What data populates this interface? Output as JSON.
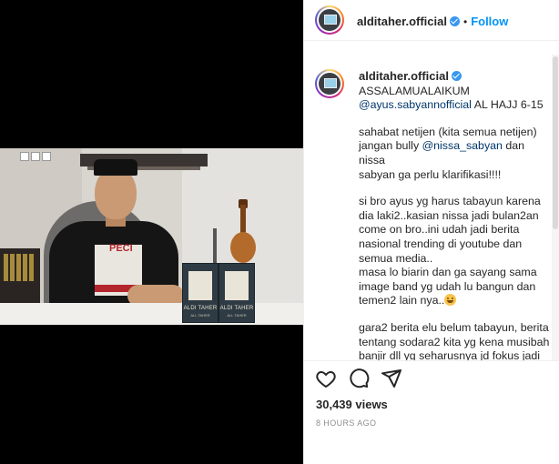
{
  "post": {
    "username": "alditaher.official",
    "dot": "•",
    "follow_label": "Follow",
    "caption": {
      "line1": "ASSALAMUALAIKUM",
      "mention1": "@ayus.sabyannofficial",
      "line2_rest": " AL HAJJ 6-15",
      "p2_a": "sahabat netijen (kita semua netijen)\njangan bully ",
      "mention2": "@nissa_sabyan",
      "p2_b": " dan nissa\nsabyan ga perlu klarifikasi!!!!",
      "p3": "si bro ayus yg harus tabayun karena\ndia laki2..kasian nissa jadi bulan2an\ncome on bro..ini udah jadi berita\nnasional trending di youtube dan\nsemua media..\nmasa lo biarin dan ga sayang sama\nimage band yg udah lu bangun dan\ntemen2 lain nya..",
      "p4": "gara2 berita elu belum tabayun, berita\ntentang sodara2 kita yg kena musibah\nbanjir dll yg seharusnya jd fokus jadi"
    },
    "views": "30,439 views",
    "timestamp": "8 HOURS AGO"
  },
  "video": {
    "box_label": "ALDI TAHER",
    "box_sub": "ALL TAHER",
    "shirt_text": "PECI"
  },
  "icons": {
    "heart": "heart-icon",
    "comment": "comment-icon",
    "share": "share-icon",
    "verified": "verified-badge-icon",
    "emoji": "smiling-face-emoji"
  },
  "colors": {
    "link": "#00376b",
    "follow": "#0095f6",
    "verified": "#3897f0",
    "muted": "#8e8e8e"
  }
}
